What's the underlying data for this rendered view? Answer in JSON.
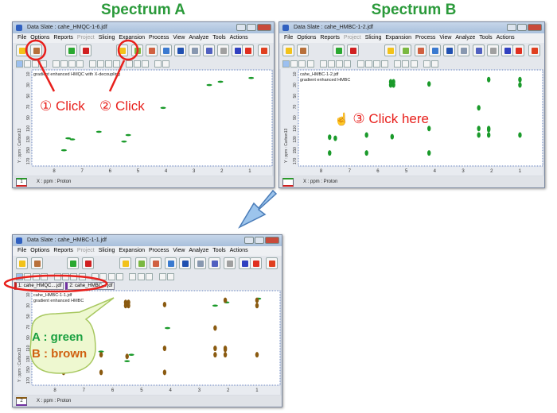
{
  "headings": {
    "a": "Spectrum A",
    "b": "Spectrum B"
  },
  "menu": [
    "File",
    "Options",
    "Reports",
    "Project",
    "Slicing",
    "Expansion",
    "Process",
    "View",
    "Analyze",
    "Tools",
    "Actions"
  ],
  "menu_disabled": "Project",
  "axes": {
    "x_label": "X : ppm : Proton",
    "y_label": "Y : ppm : Carbon13",
    "x_ticks": [
      8,
      7,
      6,
      5,
      4,
      3,
      2,
      1
    ],
    "y_ticks": [
      10,
      30,
      50,
      70,
      90,
      110,
      130,
      150,
      170
    ]
  },
  "colors": {
    "a": "#1a9a2a",
    "b": "#8a5a10",
    "annotation": "#e8201c"
  },
  "windows": [
    {
      "id": "a",
      "title": "Data Slate : cahe_HMQC-1-6.jdf",
      "caption": "gradient enhanced HMQC with X-decoupling",
      "status_badge": "1",
      "layers": [
        "a"
      ]
    },
    {
      "id": "b",
      "title": "Data Slate : cahe_HMBC-1-2.jdf",
      "file_label": "cahe_HMBC-1-2.jdf",
      "caption": "gradient enhanced HMBC",
      "status_badge": "",
      "layers": [
        "b"
      ]
    },
    {
      "id": "c",
      "title": "Data Slate : cahe_HMBC-1-1.jdf",
      "file_label": "cahe_HMBC-1-1.jdf",
      "caption": "gradient enhanced HMBC",
      "status_badge": "2",
      "tabs": [
        "1: cahe_HMQC....jdf",
        "2: cahe_HMBC-...jdf"
      ],
      "layers": [
        "a",
        "b"
      ]
    }
  ],
  "peaks": {
    "a": [
      [
        2.45,
        30
      ],
      [
        2.05,
        24
      ],
      [
        0.95,
        17
      ],
      [
        4.1,
        72
      ],
      [
        7.5,
        128
      ],
      [
        7.35,
        130
      ],
      [
        6.4,
        116
      ],
      [
        5.35,
        122
      ],
      [
        5.5,
        134
      ],
      [
        7.65,
        150
      ]
    ],
    "b": [
      [
        5.55,
        24
      ],
      [
        5.45,
        24
      ],
      [
        5.55,
        30
      ],
      [
        5.45,
        30
      ],
      [
        4.2,
        28
      ],
      [
        2.1,
        20
      ],
      [
        1.0,
        20
      ],
      [
        1.0,
        30
      ],
      [
        2.45,
        72
      ],
      [
        4.2,
        110
      ],
      [
        2.45,
        110
      ],
      [
        2.1,
        110
      ],
      [
        2.45,
        122
      ],
      [
        2.1,
        122
      ],
      [
        1.0,
        122
      ],
      [
        6.4,
        122
      ],
      [
        7.7,
        126
      ],
      [
        7.5,
        128
      ],
      [
        7.7,
        155
      ],
      [
        6.4,
        155
      ],
      [
        4.2,
        155
      ],
      [
        5.5,
        125
      ],
      [
        2.1,
        112
      ]
    ]
  },
  "annotations": {
    "click1": "① Click",
    "click2": "② Click",
    "click3": "③ Click here",
    "legend_a": "A : green",
    "legend_b": "B : brown"
  }
}
